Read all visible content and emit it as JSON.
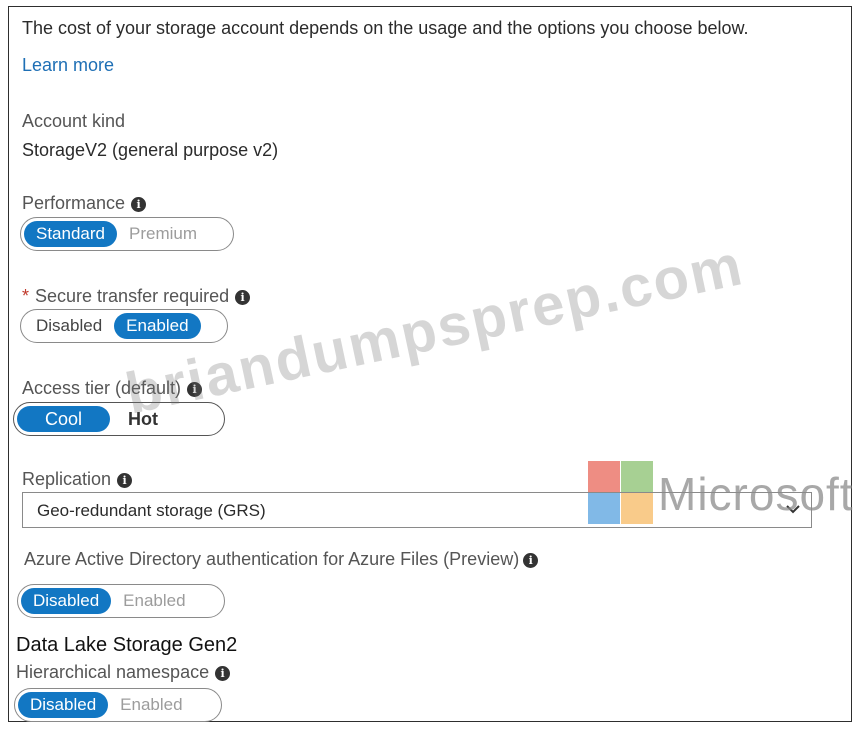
{
  "intro": {
    "text": "The cost of your storage account depends on the usage and the options you choose below.",
    "learn_more": "Learn more"
  },
  "account_kind": {
    "label": "Account kind",
    "value": "StorageV2 (general purpose v2)"
  },
  "performance": {
    "label": "Performance",
    "options": [
      "Standard",
      "Premium"
    ],
    "selected": "Standard"
  },
  "secure_transfer": {
    "required_mark": "*",
    "label": "Secure transfer required",
    "options": [
      "Disabled",
      "Enabled"
    ],
    "selected": "Enabled"
  },
  "access_tier": {
    "label": "Access tier (default)",
    "options": [
      "Cool",
      "Hot"
    ],
    "selected": "Cool"
  },
  "replication": {
    "label": "Replication",
    "value": "Geo-redundant storage (GRS)"
  },
  "aad_auth": {
    "label": "Azure Active Directory authentication for Azure Files (Preview)",
    "options": [
      "Disabled",
      "Enabled"
    ],
    "selected": "Disabled"
  },
  "data_lake": {
    "heading": "Data Lake Storage Gen2",
    "label": "Hierarchical namespace",
    "options": [
      "Disabled",
      "Enabled"
    ],
    "selected": "Disabled"
  },
  "overlays": {
    "watermark": "briandumpsprep.com",
    "logo_text": "Microsoft",
    "logo_colors": [
      "#e0301e",
      "#5ea93a",
      "#1a7fd4",
      "#f4a12a"
    ]
  },
  "icons": {
    "info": "info-icon",
    "dropdown": "chevron-down-icon"
  },
  "colors": {
    "accent": "#1277c3",
    "link": "#1e6fb5",
    "required": "#c0392b"
  }
}
